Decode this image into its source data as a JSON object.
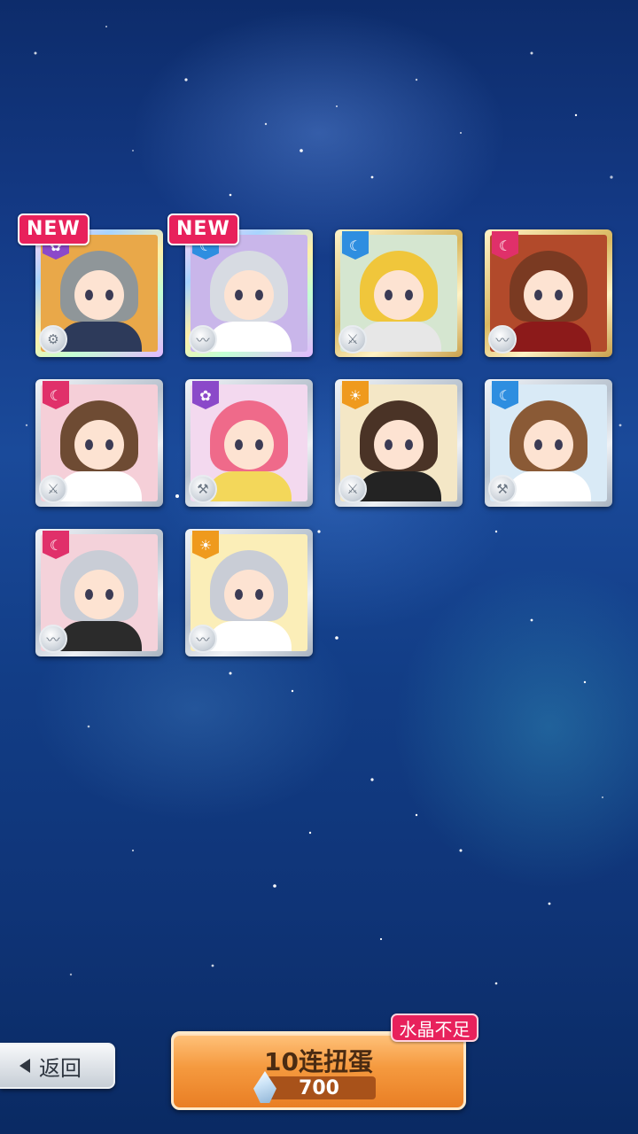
{
  "cards": [
    {
      "new": true,
      "new_label": "NEW",
      "attribute": "purple",
      "attribute_icon": "flower-icon",
      "role_icon": "gear-icon",
      "frame": "rainbow",
      "bg": "#e9a849",
      "hair": "#8f9699",
      "body": "#2d3a5a"
    },
    {
      "new": true,
      "new_label": "NEW",
      "attribute": "blue",
      "attribute_icon": "moon-icon",
      "role_icon": "wave-icon",
      "frame": "rainbow",
      "bg": "#c9b6ea",
      "hair": "#d7dbe2",
      "body": "#ffffff"
    },
    {
      "new": false,
      "new_label": "",
      "attribute": "blue",
      "attribute_icon": "moon-icon",
      "role_icon": "sword-icon",
      "frame": "gold",
      "bg": "#d5e6d0",
      "hair": "#f0c63b",
      "body": "#e7e7e7"
    },
    {
      "new": false,
      "new_label": "",
      "attribute": "red",
      "attribute_icon": "moon-icon",
      "role_icon": "wave-icon",
      "frame": "gold",
      "bg": "#b24a2b",
      "hair": "#7a3a22",
      "body": "#8c1a1a"
    },
    {
      "new": false,
      "new_label": "",
      "attribute": "red",
      "attribute_icon": "moon-icon",
      "role_icon": "sword-icon",
      "frame": "silver",
      "bg": "#f5cfd8",
      "hair": "#6e4b33",
      "body": "#ffffff"
    },
    {
      "new": false,
      "new_label": "",
      "attribute": "purple",
      "attribute_icon": "flower-icon",
      "role_icon": "hammer-icon",
      "frame": "silver",
      "bg": "#f3d9ef",
      "hair": "#ef6a8a",
      "body": "#f3d75a"
    },
    {
      "new": false,
      "new_label": "",
      "attribute": "orange",
      "attribute_icon": "sun-icon",
      "role_icon": "sword-icon",
      "frame": "silver",
      "bg": "#f4e7c6",
      "hair": "#4a3326",
      "body": "#232323"
    },
    {
      "new": false,
      "new_label": "",
      "attribute": "blue",
      "attribute_icon": "moon-icon",
      "role_icon": "hammer-icon",
      "frame": "silver",
      "bg": "#d9eaf6",
      "hair": "#8a5a36",
      "body": "#ffffff"
    },
    {
      "new": false,
      "new_label": "",
      "attribute": "red",
      "attribute_icon": "moon-icon",
      "role_icon": "wave-icon",
      "frame": "silver",
      "bg": "#f4d2da",
      "hair": "#c9cdd6",
      "body": "#2b2b2b"
    },
    {
      "new": false,
      "new_label": "",
      "attribute": "orange",
      "attribute_icon": "sun-icon",
      "role_icon": "wave-icon",
      "frame": "silver",
      "bg": "#fbeeb8",
      "hair": "#c9cdd6",
      "body": "#ffffff"
    }
  ],
  "back_button": {
    "label": "返回"
  },
  "gacha_button": {
    "label": "10连扭蛋",
    "cost": "700",
    "currency_icon": "crystal-icon"
  },
  "warning_badge": {
    "label": "水晶不足"
  }
}
